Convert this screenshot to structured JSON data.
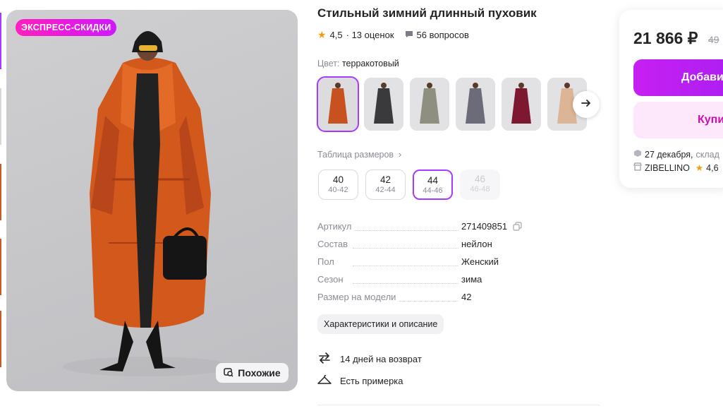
{
  "product": {
    "badge": "ЭКСПРЕСС-СКИДКИ",
    "similar_label": "Похожие",
    "title": "Стильный зимний длинный пуховик",
    "rating": "4,5",
    "reviews": "· 13 оценок",
    "questions": "56 вопросов",
    "color_label": "Цвет:",
    "color_value": "терракотовый",
    "colors": [
      "#c8521f",
      "#3a3a3c",
      "#8e8f7f",
      "#6c6b78",
      "#7d1830",
      "#dcb496"
    ],
    "size_table_label": "Таблица размеров",
    "sizes": [
      {
        "n": "40",
        "r": "40-42"
      },
      {
        "n": "42",
        "r": "42-44"
      },
      {
        "n": "44",
        "r": "44-46"
      },
      {
        "n": "46",
        "r": "46-48"
      }
    ],
    "specs": [
      {
        "k": "Артикул",
        "v": "271409851"
      },
      {
        "k": "Состав",
        "v": "нейлон"
      },
      {
        "k": "Пол",
        "v": "Женский"
      },
      {
        "k": "Сезон",
        "v": "зима"
      },
      {
        "k": "Размер на модели",
        "v": "42"
      }
    ],
    "chars_button": "Характеристики и описание",
    "return_text": "14 дней на возврат",
    "fitting_text": "Есть примерка"
  },
  "card": {
    "price": "21 866 ₽",
    "old_price": "49",
    "add_label": "Добави",
    "buy_label": "Купи",
    "delivery": "27 декабря,",
    "delivery_rest": "склад",
    "seller": "ZIBELLINO",
    "seller_rating": "4,6"
  },
  "colors": {
    "accent": "#a73afd",
    "badge": "#e61cd6",
    "star": "#f39c12"
  }
}
